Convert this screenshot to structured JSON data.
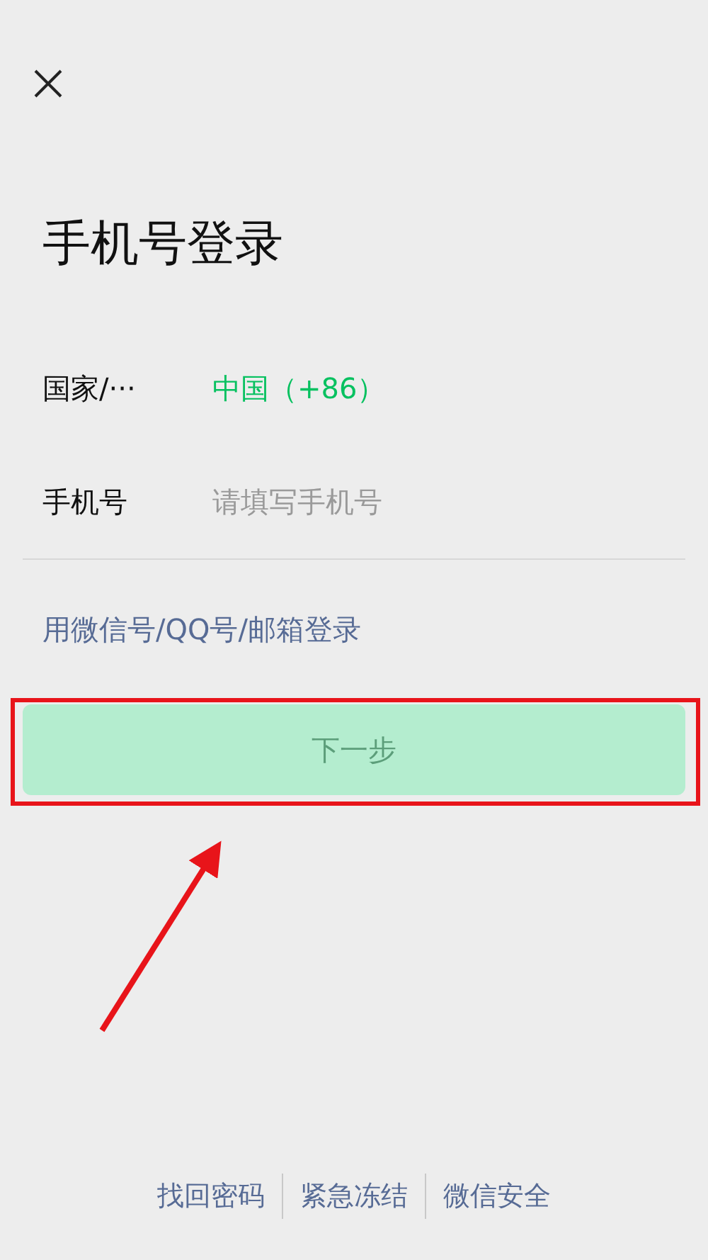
{
  "title": "手机号登录",
  "fields": [
    {
      "label": "国家/···",
      "value": "中国（+86）"
    },
    {
      "label": "手机号",
      "placeholder": "请填写手机号"
    }
  ],
  "alt_login_link": "用微信号/QQ号/邮箱登录",
  "next_button": {
    "label": "下一步",
    "disabled": true
  },
  "footer_links": [
    "找回密码",
    "紧急冻结",
    "微信安全"
  ]
}
